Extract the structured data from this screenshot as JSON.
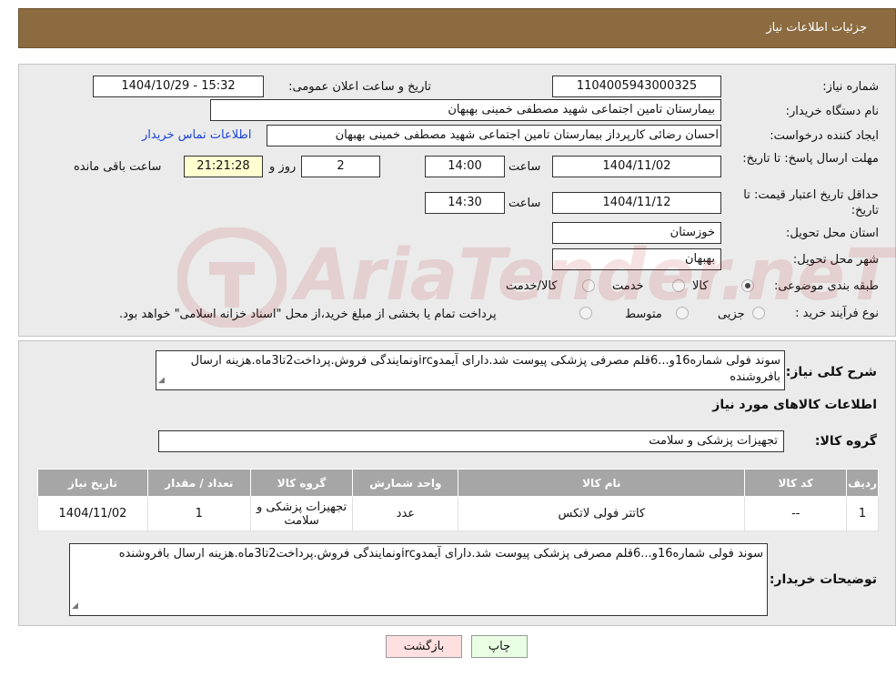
{
  "header": {
    "title": "جزئیات اطلاعات نیاز"
  },
  "form": {
    "need_number_label": "شماره نیاز:",
    "need_number": "1104005943000325",
    "announce_label": "تاریخ و ساعت اعلان عمومی:",
    "announce_value": "1404/10/29 - 15:32",
    "buyer_org_label": "نام دستگاه خریدار:",
    "buyer_org": "بیمارستان تامین اجتماعی شهید مصطفی خمینی بهبهان",
    "creator_label": "ایجاد کننده درخواست:",
    "creator": "احسان رضائی کارپرداز بیمارستان تامین اجتماعی شهید مصطفی خمینی بهبهان",
    "contact_link": "اطلاعات تماس خریدار",
    "deadline_label": "مهلت ارسال پاسخ: تا تاریخ:",
    "deadline_date": "1404/11/02",
    "time_label": "ساعت",
    "deadline_time": "14:00",
    "days_value": "2",
    "days_label": "روز و",
    "remaining_value": "21:21:28",
    "remaining_label": "ساعت باقی مانده",
    "validity_label": "حداقل تاریخ اعتبار قیمت: تا تاریخ:",
    "validity_date": "1404/11/12",
    "validity_time": "14:30",
    "province_label": "استان محل تحویل:",
    "province": "خوزستان",
    "city_label": "شهر محل تحویل:",
    "city": "بهبهان",
    "category_label": "طبقه بندی موضوعی:",
    "category_options": [
      "کالا",
      "خدمت",
      "کالا/خدمت"
    ],
    "category_selected": "کالا",
    "process_label": "نوع فرآیند خرید :",
    "process_options": [
      "جزیی",
      "متوسط"
    ],
    "process_note": "پرداخت تمام یا بخشی از مبلغ خرید،از محل \"اسناد خزانه اسلامی\" خواهد بود."
  },
  "details": {
    "summary_label": "شرح کلی نیاز:",
    "summary": "سوند فولی شماره16و...6قلم مصرفی پزشکی پیوست شد.دارای آیمدوircونمایندگی فروش.پرداخت2تا3ماه.هزینه ارسال بافروشنده",
    "items_title": "اطلاعات کالاهای مورد نیاز",
    "group_label": "گروه کالا:",
    "group_value": "تجهیزات پزشکی و سلامت",
    "table": {
      "headers": [
        "ردیف",
        "کد کالا",
        "نام کالا",
        "واحد شمارش",
        "گروه کالا",
        "تعداد / مقدار",
        "تاریخ نیاز"
      ],
      "rows": [
        [
          "1",
          "--",
          "کاتتر فولی لاتکس",
          "عدد",
          "تجهیزات پزشکی و سلامت",
          "1",
          "1404/11/02"
        ]
      ]
    },
    "buyer_notes_label": "توضیحات خریدار:",
    "buyer_notes": "سوند فولی شماره16و...6قلم مصرفی پزشکی پیوست شد.دارای آیمدوircونمایندگی فروش.پرداخت2تا3ماه.هزینه ارسال بافروشنده"
  },
  "buttons": {
    "print": "چاپ",
    "back": "بازگشت"
  },
  "watermark": {
    "text": "AriaTender.neT"
  },
  "colors": {
    "header_bg": "#8b6b3f",
    "panel_bg": "#ebebeb",
    "table_header": "#a6a6a6",
    "link": "#1a44d6"
  }
}
